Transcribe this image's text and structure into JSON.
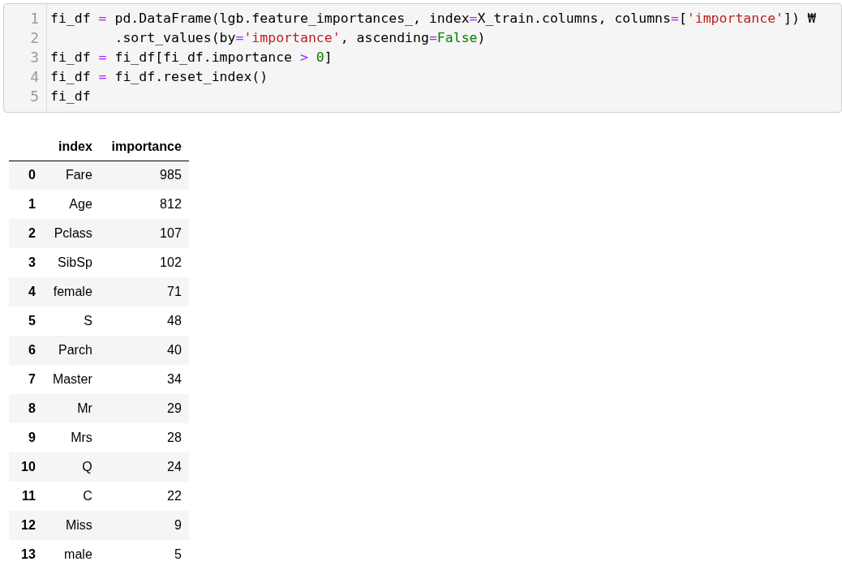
{
  "code_cell": {
    "lines": [
      {
        "number": "1",
        "tokens": [
          {
            "kind": "plain",
            "text": "fi_df "
          },
          {
            "kind": "op",
            "text": "="
          },
          {
            "kind": "plain",
            "text": " pd.DataFrame(lgb.feature_importances_, index"
          },
          {
            "kind": "op",
            "text": "="
          },
          {
            "kind": "plain",
            "text": "X_train.columns, columns"
          },
          {
            "kind": "op",
            "text": "="
          },
          {
            "kind": "plain",
            "text": "["
          },
          {
            "kind": "str",
            "text": "'importance'"
          },
          {
            "kind": "plain",
            "text": "]) ₩"
          }
        ]
      },
      {
        "number": "2",
        "tokens": [
          {
            "kind": "plain",
            "text": "        .sort_values(by"
          },
          {
            "kind": "op",
            "text": "="
          },
          {
            "kind": "str",
            "text": "'importance'"
          },
          {
            "kind": "plain",
            "text": ", ascending"
          },
          {
            "kind": "op",
            "text": "="
          },
          {
            "kind": "kw",
            "text": "False"
          },
          {
            "kind": "plain",
            "text": ")"
          }
        ]
      },
      {
        "number": "3",
        "tokens": [
          {
            "kind": "plain",
            "text": "fi_df "
          },
          {
            "kind": "op",
            "text": "="
          },
          {
            "kind": "plain",
            "text": " fi_df[fi_df.importance "
          },
          {
            "kind": "op",
            "text": "> "
          },
          {
            "kind": "num",
            "text": "0"
          },
          {
            "kind": "plain",
            "text": "]"
          }
        ]
      },
      {
        "number": "4",
        "tokens": [
          {
            "kind": "plain",
            "text": "fi_df "
          },
          {
            "kind": "op",
            "text": "="
          },
          {
            "kind": "plain",
            "text": " fi_df.reset_index()"
          }
        ]
      },
      {
        "number": "5",
        "tokens": [
          {
            "kind": "plain",
            "text": "fi_df"
          }
        ]
      }
    ]
  },
  "output_table": {
    "columns": [
      "index",
      "importance"
    ],
    "rows": [
      {
        "row_index": "0",
        "index": "Fare",
        "importance": "985"
      },
      {
        "row_index": "1",
        "index": "Age",
        "importance": "812"
      },
      {
        "row_index": "2",
        "index": "Pclass",
        "importance": "107"
      },
      {
        "row_index": "3",
        "index": "SibSp",
        "importance": "102"
      },
      {
        "row_index": "4",
        "index": "female",
        "importance": "71"
      },
      {
        "row_index": "5",
        "index": "S",
        "importance": "48"
      },
      {
        "row_index": "6",
        "index": "Parch",
        "importance": "40"
      },
      {
        "row_index": "7",
        "index": "Master",
        "importance": "34"
      },
      {
        "row_index": "8",
        "index": "Mr",
        "importance": "29"
      },
      {
        "row_index": "9",
        "index": "Mrs",
        "importance": "28"
      },
      {
        "row_index": "10",
        "index": "Q",
        "importance": "24"
      },
      {
        "row_index": "11",
        "index": "C",
        "importance": "22"
      },
      {
        "row_index": "12",
        "index": "Miss",
        "importance": "9"
      },
      {
        "row_index": "13",
        "index": "male",
        "importance": "5"
      }
    ]
  }
}
